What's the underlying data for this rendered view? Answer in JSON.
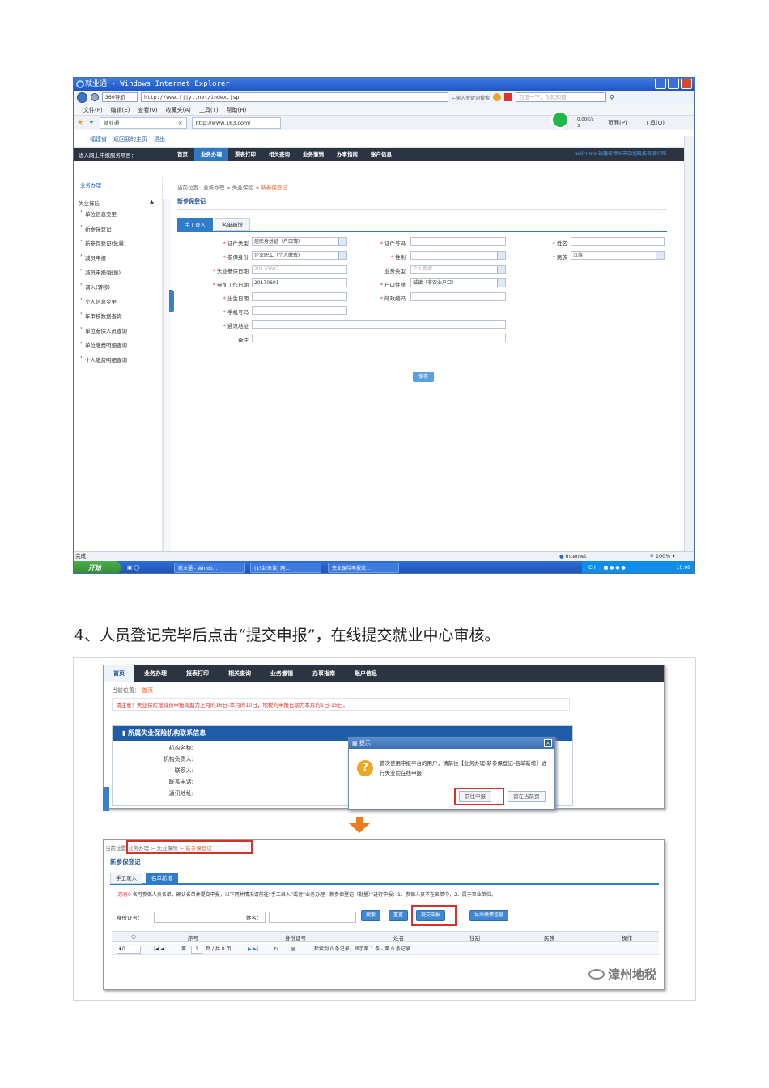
{
  "win1": {
    "title": "就业通 - Windows Internet Explorer",
    "nav_btn": "360导航",
    "url": "http://www.fjjyt.net/index.jsp",
    "search_hint": "←输入关键词搜索",
    "search_box": "百度一下，你就知道",
    "menu": [
      "文件(F)",
      "编辑(E)",
      "查看(V)",
      "收藏夹(A)",
      "工具(T)",
      "帮助(H)"
    ],
    "tab1": "就业通",
    "tab2": "http://www.163.com/",
    "net_speed": "0.00K/s",
    "net_count": "3",
    "page_menu": "页面(P)",
    "tools_menu": "工具(O)",
    "links": [
      "福建省",
      "返回我的主页",
      "退出"
    ],
    "enter_label": "进入网上申报服务项目：",
    "nav": [
      "首页",
      "业务办理",
      "票表打印",
      "相关查询",
      "业务撤销",
      "办事指南",
      "账户信息"
    ],
    "welcome": "welcome:福建省漳州市中旭科技有限公司",
    "sidebar_head": "业务办理",
    "sidebar_group": "失业保险",
    "sidebar_items": [
      "单位信息变更",
      "新参保登记",
      "新参保登记(批量)",
      "减员申报",
      "减员申报(批量)",
      "调入(转移)",
      "个人信息变更",
      "年审核数据查询",
      "单位参保人员查询",
      "单位缴费明细查询",
      "个人缴费明细查询"
    ],
    "breadcrumb": [
      "当前位置",
      "业务办理",
      "失业保险",
      "新参保登记"
    ],
    "page_title": "新参保登记",
    "tabs": [
      "手工录入",
      "名单新增"
    ],
    "form": {
      "id_type_label": "证件类型",
      "id_type": "居民身份证（户口簿）",
      "id_no_label": "证件号码",
      "name_label": "姓名",
      "role_label": "参保身份",
      "role": "企业职工（个人缴费）",
      "gender_label": "性别",
      "ethnic_label": "民族",
      "ethnic": "汉族",
      "unemp_date_label": "失业参保日期",
      "unemp_date": "20170607",
      "biz_type_label": "业务类型",
      "biz_type": "个人新增",
      "work_date_label": "参加工作日期",
      "work_date": "20170601",
      "household_label": "户口性质",
      "household": "城镇（非农业户口）",
      "birth_label": "出生日期",
      "postcode_label": "邮政编码",
      "phone_label": "手机号码",
      "address_label": "通讯地址",
      "remark_label": "备注",
      "save": "保存"
    },
    "status_left": "完成",
    "status_zone": "Internet",
    "status_zoom": "100%",
    "start": "开始",
    "task1": "就业通 - Windo...",
    "task2": "(15封未读) 网...",
    "task3": "失业保险申报流...",
    "tray_lang": "CH",
    "tray_time": "10:08"
  },
  "instruction": "4、人员登记完毕后点击“提交申报”，在线提交就业中心审核。",
  "shot2": {
    "nav": [
      "首页",
      "业务办理",
      "报表打印",
      "相关查询",
      "业务撤销",
      "办事指南",
      "账户信息"
    ],
    "crumb_label": "当前位置：",
    "crumb_home": "首页",
    "notice": "请注意！失业保险增减员申报周期为上月的16日-本月的10日，地税的申报日期为本月的1日-15日。",
    "info_title": "所属失业保险机构联系信息",
    "info_rows": [
      "机构名称:",
      "机构负责人:",
      "联系人:",
      "联系电话:",
      "通讯地址:"
    ],
    "dialog_title": "提示",
    "dialog_msg": "首次使用申报平台的用户，请前往【业务办理-新参保登记-名单新增】进行失业险在线申报",
    "dialog_btn1": "前往申报",
    "dialog_btn2": "留在当前页",
    "crumb2": [
      "当前位置",
      "业务办理",
      "失业保险",
      "新参保登记"
    ],
    "title2": "新参保登记",
    "tabs2": [
      "手工录入",
      "名单新增"
    ],
    "tip_label": "【您有0",
    "tip_text": "名可参保人员名单，确认名单并提交申报，以下两种情况请前往“手工录入”或者“业务办理 - 新参保登记（批量）”进行申报：1、参保人员不在名单中，2、属于事业单位。",
    "id_label": "身份证号：",
    "name_label": "姓名：",
    "btn_search": "搜索",
    "btn_reset": "重置",
    "btn_submit": "提交申报",
    "btn_export": "导出缴费信息",
    "cols": [
      "序号",
      "身份证号",
      "姓名",
      "性别",
      "民族",
      "操作"
    ],
    "page_size": "10",
    "page_prefix": "第",
    "page_no": "1",
    "page_total": "页 / 共 0 页",
    "page_info": "检索到 0 条记录，显示第 1 条 - 第 0 条记录",
    "watermark": "漳州地税"
  }
}
